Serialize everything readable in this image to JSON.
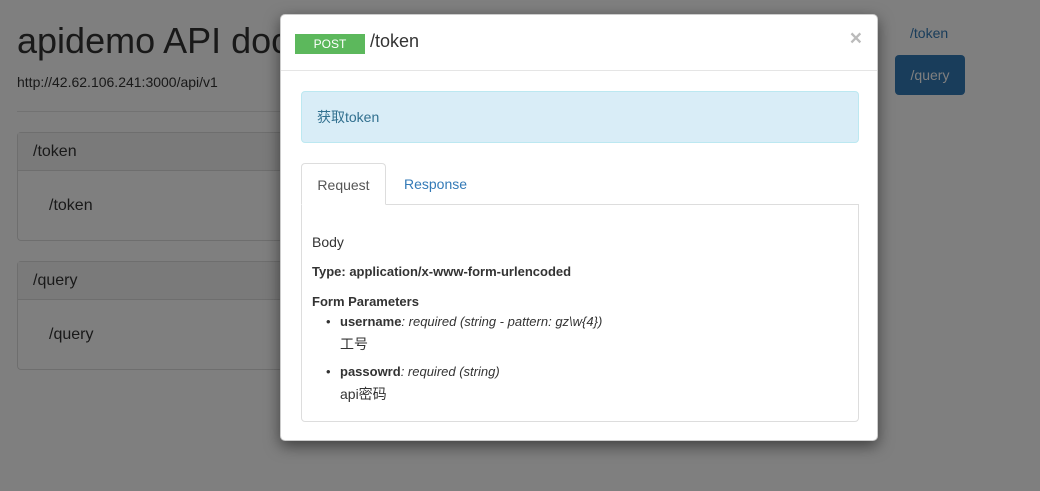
{
  "page": {
    "title": "apidemo API doc",
    "base_url": "http://42.62.106.241:3000/api/v1",
    "panels": [
      {
        "heading": "/token",
        "item": "/token"
      },
      {
        "heading": "/query",
        "item": "/query"
      }
    ],
    "nav": {
      "link": "/token",
      "active": "/query"
    }
  },
  "modal": {
    "method": "POST",
    "path": "/token",
    "close_symbol": "×",
    "description": "获取token",
    "tabs": {
      "request": "Request",
      "response": "Response"
    },
    "body": {
      "label": "Body",
      "type_label": "Type: application/x-www-form-urlencoded",
      "form_params_label": "Form Parameters",
      "params": [
        {
          "name": "username",
          "meta": ": required (string - pattern: gz\\w{4})",
          "description": "工号"
        },
        {
          "name": "passowrd",
          "meta": ": required (string)",
          "description": "api密码"
        }
      ]
    }
  },
  "colors": {
    "method_badge": "#5cb85c",
    "alert_bg": "#d9edf7",
    "alert_text": "#31708f",
    "link": "#337ab7",
    "backdrop": "rgba(0,0,0,0.5)"
  }
}
